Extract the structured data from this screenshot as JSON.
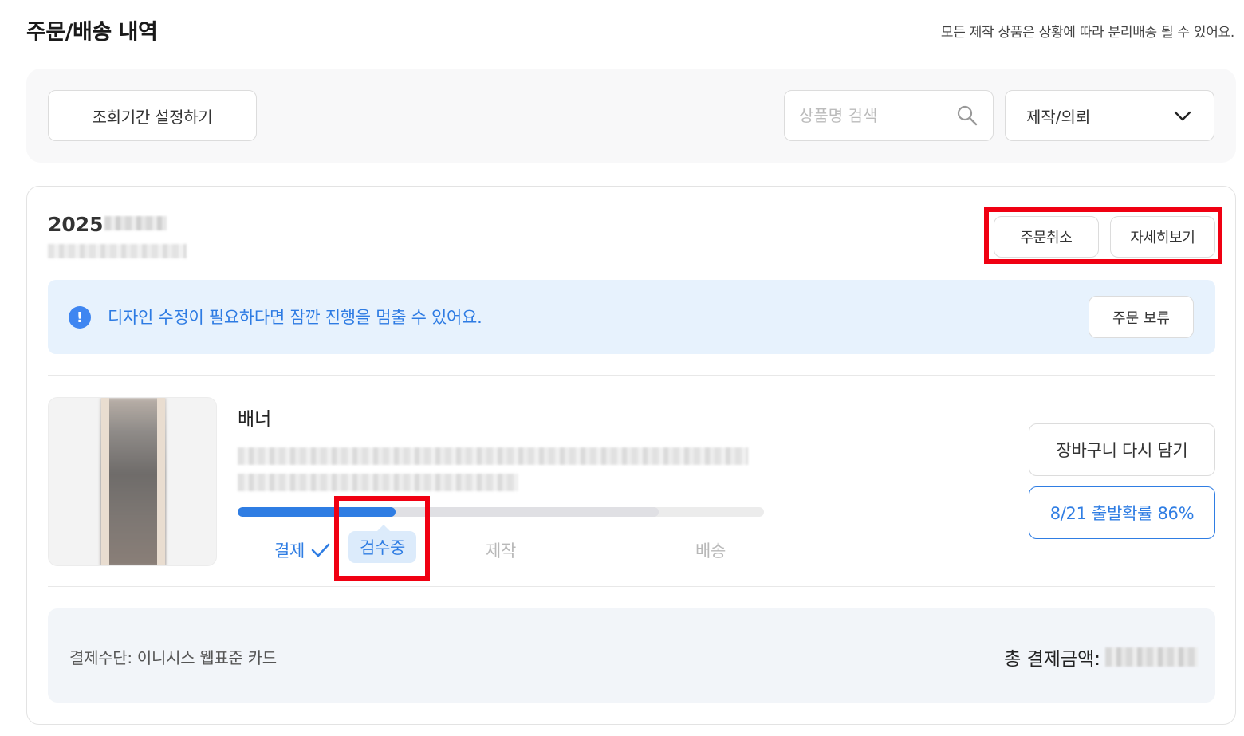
{
  "header": {
    "title": "주문/배송 내역",
    "notice": "모든 제작 상품은 상황에 따라 분리배송 될 수 있어요."
  },
  "filters": {
    "period_button": "조회기간 설정하기",
    "search_placeholder": "상품명 검색",
    "category_selected": "제작/의뢰"
  },
  "order": {
    "date_prefix": "2025",
    "cancel_button": "주문취소",
    "detail_button": "자세히보기",
    "notice_banner": {
      "icon": "!",
      "text": "디자인 수정이 필요하다면 잠깐 진행을 멈출 수 있어요.",
      "hold_button": "주문 보류"
    },
    "item": {
      "name": "배너",
      "progress_percent": 30,
      "steps": [
        {
          "label": "결제",
          "state": "done"
        },
        {
          "label": "검수중",
          "state": "current"
        },
        {
          "label": "제작",
          "state": "pending"
        },
        {
          "label": "배송",
          "state": "pending"
        }
      ],
      "recart_button": "장바구니 다시 담기",
      "eta_button": "8/21 출발확률 86%"
    },
    "payment": {
      "method": "결제수단: 이니시스 웹표준 카드",
      "total_label": "총 결제금액:"
    }
  },
  "colors": {
    "accent": "#2f7de3",
    "highlight_box": "#f00012",
    "banner_bg": "#e7f2fd",
    "step_pending": "#b8b8b8"
  }
}
